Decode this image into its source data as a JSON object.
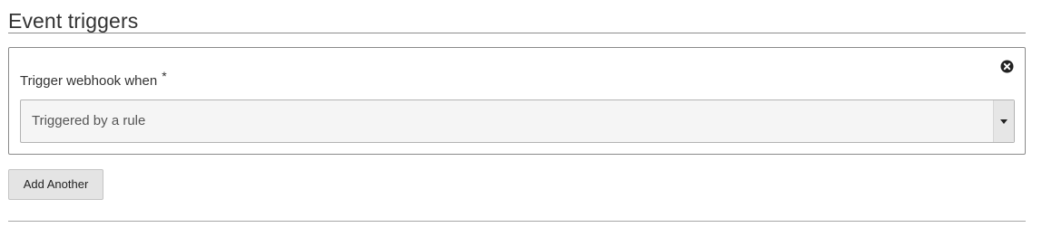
{
  "section": {
    "title": "Event triggers"
  },
  "trigger": {
    "label": "Trigger webhook when",
    "required_mark": "*",
    "select_value": "Triggered by a rule",
    "remove_icon": "circle-x-icon",
    "caret_icon": "caret-down-icon"
  },
  "actions": {
    "add_another_label": "Add Another"
  }
}
